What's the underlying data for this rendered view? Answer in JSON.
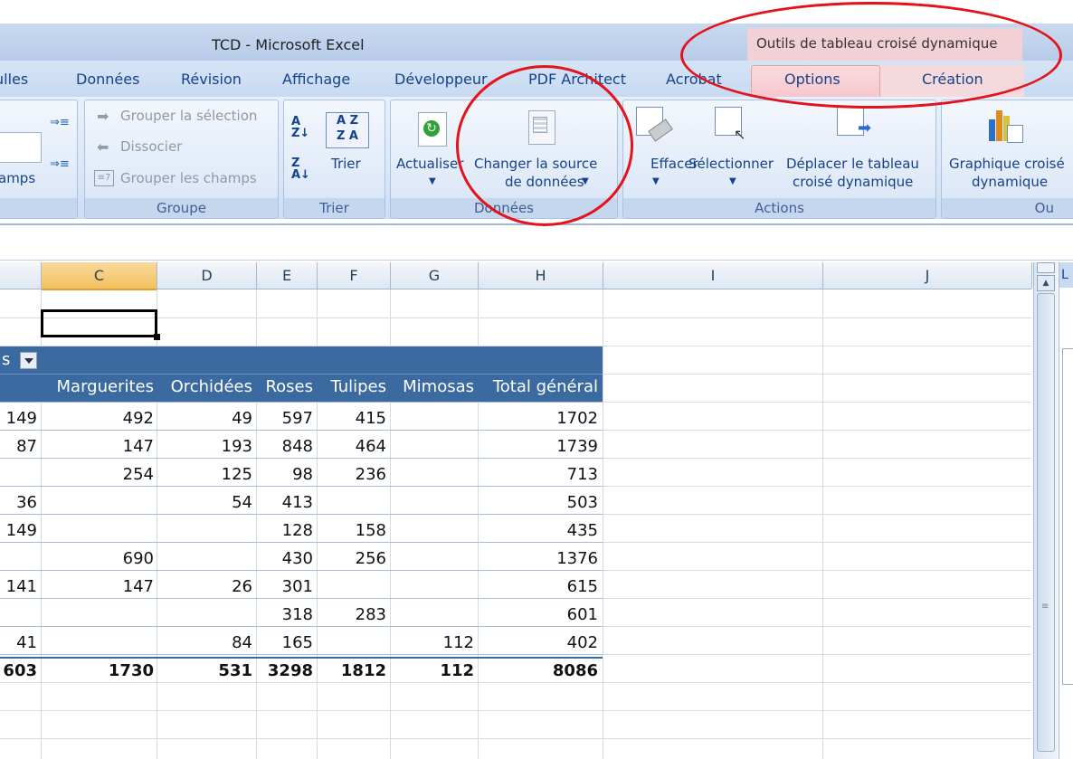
{
  "window": {
    "title": "TCD - Microsoft Excel",
    "context_tools": "Outils de tableau croisé dynamique"
  },
  "tabs": [
    "ulles",
    "Données",
    "Révision",
    "Affichage",
    "Développeur",
    "PDF Architect",
    "Acrobat",
    "Options",
    "Création"
  ],
  "ribbon": {
    "left_fragment": "amps",
    "groupe": {
      "title": "Groupe",
      "grouper": "Grouper la sélection",
      "dissocier": "Dissocier",
      "grouper_champs": "Grouper les champs"
    },
    "trier": {
      "title": "Trier",
      "trier": "Trier"
    },
    "donnees": {
      "title": "Données",
      "actualiser": "Actualiser",
      "changer_line1": "Changer la source",
      "changer_line2": "de données"
    },
    "actions": {
      "title": "Actions",
      "effacer": "Effacer",
      "selectionner": "Sélectionner",
      "deplacer_line1": "Déplacer le tableau",
      "deplacer_line2": "croisé dynamique"
    },
    "graph": {
      "line1": "Graphique croisé",
      "line2": "dynamique",
      "title_fragment": "Ou"
    }
  },
  "columns": [
    "C",
    "D",
    "E",
    "F",
    "G",
    "H",
    "I",
    "J"
  ],
  "pivot": {
    "header_fragment": "s",
    "headers": [
      "Marguerites",
      "Orchidées",
      "Roses",
      "Tulipes",
      "Mimosas",
      "Total général"
    ],
    "rows": [
      [
        "149",
        "492",
        "49",
        "597",
        "415",
        "",
        "1702"
      ],
      [
        "87",
        "147",
        "193",
        "848",
        "464",
        "",
        "1739"
      ],
      [
        "",
        "254",
        "125",
        "98",
        "236",
        "",
        "713"
      ],
      [
        "36",
        "",
        "54",
        "413",
        "",
        "",
        "503"
      ],
      [
        "149",
        "",
        "",
        "128",
        "158",
        "",
        "435"
      ],
      [
        "",
        "690",
        "",
        "430",
        "256",
        "",
        "1376"
      ],
      [
        "141",
        "147",
        "26",
        "301",
        "",
        "",
        "615"
      ],
      [
        "",
        "",
        "",
        "318",
        "283",
        "",
        "601"
      ],
      [
        "41",
        "",
        "84",
        "165",
        "",
        "112",
        "402"
      ]
    ],
    "totals": [
      "603",
      "1730",
      "531",
      "3298",
      "1812",
      "112",
      "8086"
    ]
  },
  "rightpane_fragment": "L"
}
